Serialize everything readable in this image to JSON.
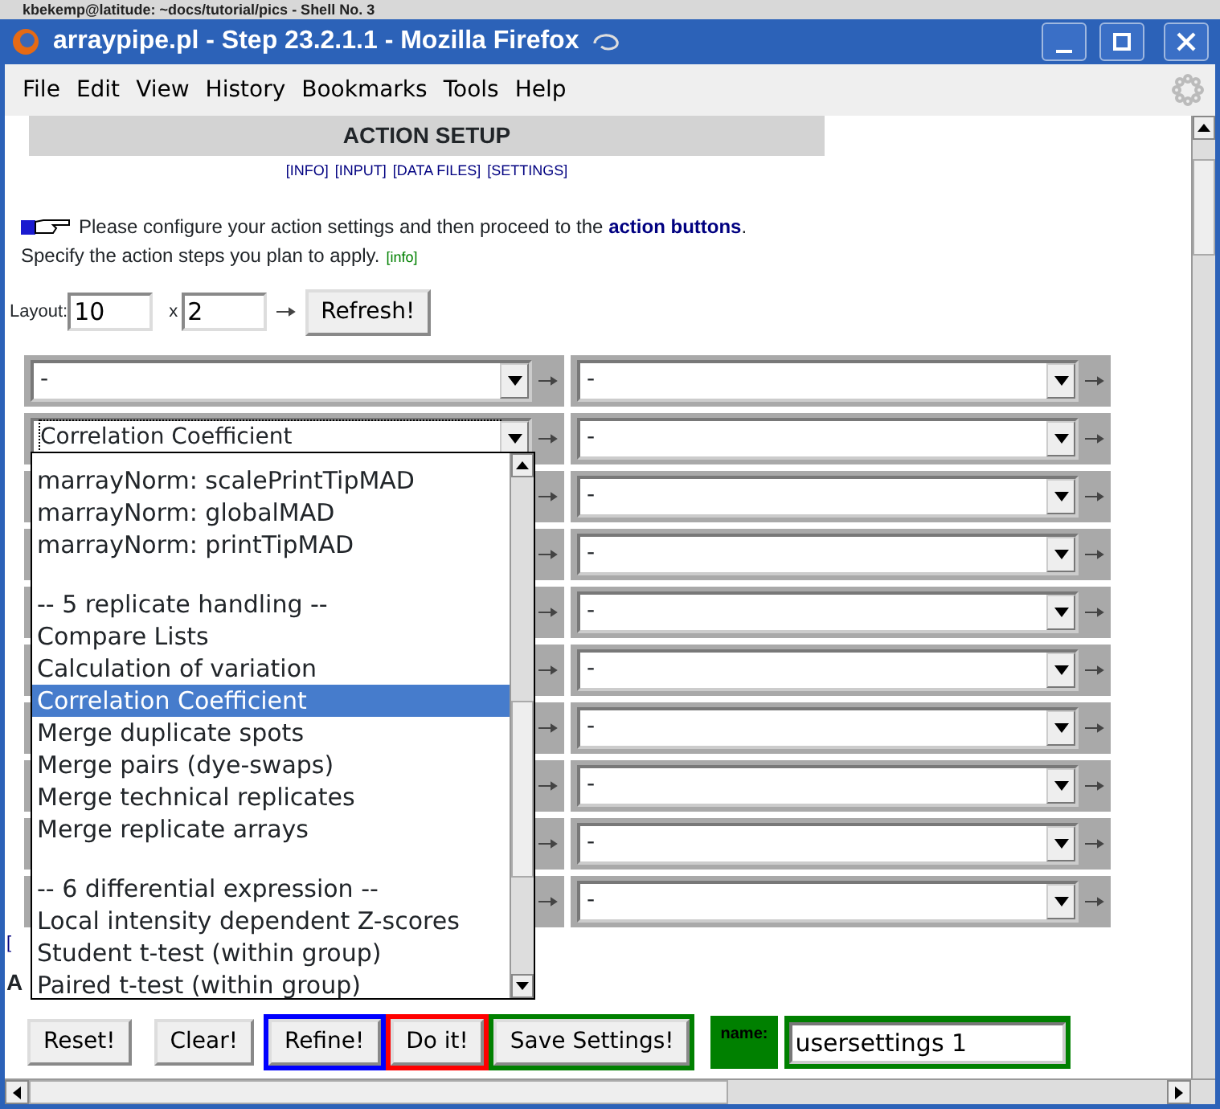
{
  "background_window": {
    "title": "kbekemp@latitude: ~docs/tutorial/pics - Shell No. 3"
  },
  "window": {
    "title": "arraypipe.pl - Step 23.2.1.1 - Mozilla Firefox"
  },
  "menu": [
    "File",
    "Edit",
    "View",
    "History",
    "Bookmarks",
    "Tools",
    "Help"
  ],
  "page": {
    "heading": "ACTION SETUP",
    "nav_links": [
      "[INFO]",
      "[INPUT]",
      "[DATA FILES]",
      "[SETTINGS]"
    ],
    "intro": "Please configure your action settings and then proceed to the **action buttons**.",
    "hint": "Specify the action steps you plan to apply.",
    "hint_link": "[info]",
    "layout": {
      "label": "Layout:",
      "rows": "10",
      "separator": "x",
      "columns": "2",
      "button": "Refresh!"
    },
    "grid": [
      {
        "left": {
          "value": "-",
          "focused": false
        },
        "right": {
          "value": "-",
          "focused": false
        }
      },
      {
        "left": {
          "value": "Correlation Coefficient",
          "focused": true
        },
        "right": {
          "value": "-",
          "focused": false
        }
      },
      {
        "right": {
          "value": "-",
          "focused": false
        }
      },
      {
        "right": {
          "value": "-",
          "focused": false
        }
      },
      {
        "right": {
          "value": "-",
          "focused": false
        }
      },
      {
        "right": {
          "value": "-",
          "focused": false
        }
      },
      {
        "right": {
          "value": "-",
          "focused": false
        }
      },
      {
        "right": {
          "value": "-",
          "focused": false
        }
      },
      {
        "right": {
          "value": "-",
          "focused": false
        }
      },
      {
        "right": {
          "value": "-",
          "focused": false
        }
      }
    ],
    "fragments": [
      "[",
      "A"
    ],
    "dropdown": {
      "items": [
        {
          "kind": "option",
          "label": "marrayNorm: scalePrintTipMAD",
          "selected": false
        },
        {
          "kind": "option",
          "label": "marrayNorm: globalMAD",
          "selected": false
        },
        {
          "kind": "option",
          "label": "marrayNorm: printTipMAD",
          "selected": false
        },
        {
          "kind": "blank"
        },
        {
          "kind": "option",
          "label": "-- 5 replicate handling --",
          "selected": false
        },
        {
          "kind": "option",
          "label": "Compare Lists",
          "selected": false
        },
        {
          "kind": "option",
          "label": "Calculation of variation",
          "selected": false
        },
        {
          "kind": "option",
          "label": "Correlation Coefficient",
          "selected": true
        },
        {
          "kind": "option",
          "label": "Merge duplicate spots",
          "selected": false
        },
        {
          "kind": "option",
          "label": "Merge pairs (dye-swaps)",
          "selected": false
        },
        {
          "kind": "option",
          "label": "Merge technical replicates",
          "selected": false
        },
        {
          "kind": "option",
          "label": "Merge replicate arrays",
          "selected": false
        },
        {
          "kind": "blank"
        },
        {
          "kind": "option",
          "label": "-- 6 differential expression --",
          "selected": false
        },
        {
          "kind": "option",
          "label": "Local intensity dependent Z-scores",
          "selected": false
        },
        {
          "kind": "option",
          "label": "Student t-test (within group)",
          "selected": false
        },
        {
          "kind": "option",
          "label": "Paired t-test (within group)",
          "selected": false
        }
      ]
    },
    "buttons": [
      {
        "label": "Reset!"
      },
      {
        "label": "Clear!"
      },
      {
        "label": "Refine!",
        "color": "#0000ff"
      },
      {
        "label": "Do it!",
        "color": "#ff0000"
      },
      {
        "label": "Save Settings!",
        "color": "#008000"
      }
    ],
    "save_name": {
      "label": "name:",
      "value": "usersettings 1"
    }
  }
}
